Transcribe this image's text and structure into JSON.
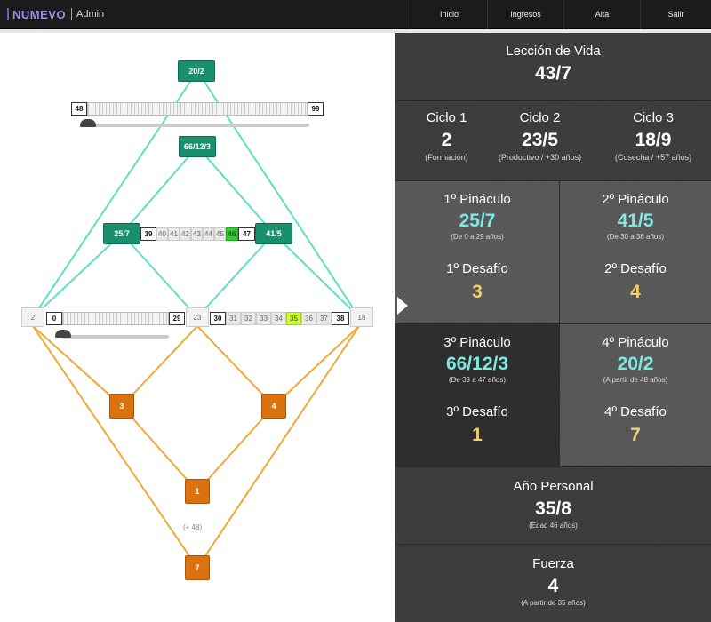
{
  "app": {
    "brand": "NUMEVO",
    "section": "Admin"
  },
  "nav": {
    "items": [
      {
        "label": "Inicio"
      },
      {
        "label": "Ingresos"
      },
      {
        "label": "Alta"
      },
      {
        "label": "Salir"
      }
    ]
  },
  "chart": {
    "top_box": "20/2",
    "top_ruler": {
      "start": "48",
      "end": "99"
    },
    "mid_box": "66/12/3",
    "left_box": "25/7",
    "right_box": "41/5",
    "middle_sequence": [
      "39",
      "40",
      "41",
      "42",
      "43",
      "44",
      "45",
      "46",
      "47"
    ],
    "base_left": "2",
    "base_ruler": {
      "start": "0",
      "end": "29"
    },
    "base_middle": "23",
    "base_sequence": [
      "30",
      "31",
      "32",
      "33",
      "34",
      "35",
      "36",
      "37",
      "38"
    ],
    "base_right": "18",
    "lower_left": "3",
    "lower_right": "4",
    "lower_center": "1",
    "bottom": "7",
    "note": "(+ 48)"
  },
  "panel": {
    "leccion": {
      "title": "Lección de Vida",
      "value": "43/7"
    },
    "ciclos": [
      {
        "title": "Ciclo 1",
        "value": "2",
        "sub": "(Formación)"
      },
      {
        "title": "Ciclo 2",
        "value": "23/5",
        "sub": "(Productivo / +30 años)"
      },
      {
        "title": "Ciclo 3",
        "value": "18/9",
        "sub": "(Cosecha / +57 años)"
      }
    ],
    "pin1": {
      "title": "1º Pináculo",
      "value": "25/7",
      "sub": "(De 0 a 29 años)"
    },
    "pin2": {
      "title": "2º Pináculo",
      "value": "41/5",
      "sub": "(De 30 a 38 años)"
    },
    "des1": {
      "title": "1º Desafío",
      "value": "3"
    },
    "des2": {
      "title": "2º Desafío",
      "value": "4"
    },
    "pin3": {
      "title": "3º Pináculo",
      "value": "66/12/3",
      "sub": "(De 39 a 47 años)"
    },
    "pin4": {
      "title": "4º Pináculo",
      "value": "20/2",
      "sub": "(A partir de 48 años)"
    },
    "des3": {
      "title": "3º Desafío",
      "value": "1"
    },
    "des4": {
      "title": "4º Desafío",
      "value": "7"
    },
    "anio": {
      "title": "Año Personal",
      "value": "35/8",
      "sub": "(Edad 46 años)"
    },
    "fuerza": {
      "title": "Fuerza",
      "value": "4",
      "sub": "(A partir de 35 años)"
    }
  }
}
